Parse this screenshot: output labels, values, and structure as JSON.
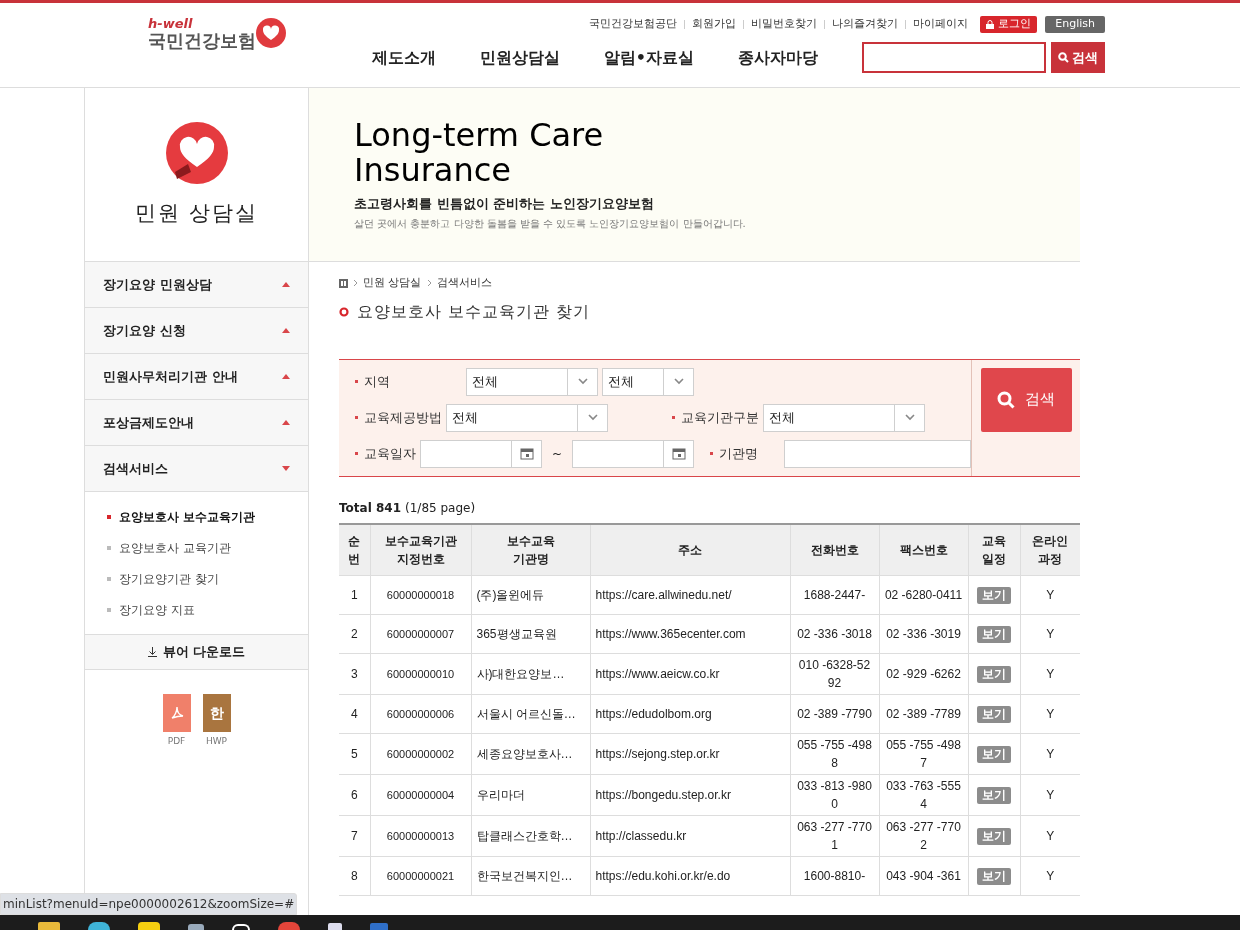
{
  "header": {
    "logo_tagline": "h-well",
    "logo_name": "국민건강보험",
    "util_links": [
      "국민건강보험공단",
      "회원가입",
      "비밀번호찾기",
      "나의즐겨찾기",
      "마이페이지"
    ],
    "login_button": "로그인",
    "english_button": "English",
    "nav": [
      "제도소개",
      "민원상담실",
      "알림•자료실",
      "종사자마당"
    ],
    "search_button": "검색"
  },
  "sidebar": {
    "title": "민원 상담실",
    "items": [
      {
        "label": "장기요양 민원상담",
        "expanded": false
      },
      {
        "label": "장기요양 신청",
        "expanded": false
      },
      {
        "label": "민원사무처리기관 안내",
        "expanded": false
      },
      {
        "label": "포상금제도안내",
        "expanded": false
      },
      {
        "label": "검색서비스",
        "expanded": true,
        "children": [
          {
            "label": "요양보호사 보수교육기관",
            "selected": true
          },
          {
            "label": "요양보호사 교육기관",
            "selected": false
          },
          {
            "label": "장기요양기관 찾기",
            "selected": false
          },
          {
            "label": "장기요양 지표",
            "selected": false
          }
        ]
      }
    ],
    "download": "뷰어 다운로드",
    "viewers": [
      {
        "kind": "pdf",
        "label": "PDF"
      },
      {
        "kind": "hwp",
        "label": "HWP",
        "glyph": "한"
      }
    ]
  },
  "banner": {
    "title_line1": "Long-term Care",
    "title_line2": "Insurance",
    "subtitle": "초고령사회를 빈틈없이 준비하는 노인장기요양보험",
    "description": "살던 곳에서 충분하고 다양한 돌봄을 받을 수 있도록 노인장기요양보험이 만들어갑니다."
  },
  "breadcrumb": [
    "민원 상담실",
    "검색서비스"
  ],
  "page_title": "요양보호사 보수교육기관 찾기",
  "filters": {
    "region_label": "지역",
    "region_1": "전체",
    "region_2": "전체",
    "method_label": "교육제공방법",
    "method": "전체",
    "type_label": "교육기관구분",
    "type": "전체",
    "date_label": "교육일자",
    "date_sep": "~",
    "name_label": "기관명",
    "search_button": "검색"
  },
  "total": {
    "label": "Total 841",
    "pages": "(1/85 page)"
  },
  "table": {
    "columns": [
      "순\n번",
      "보수교육기관\n지정번호",
      "보수교육\n기관명",
      "주소",
      "전화번호",
      "팩스번호",
      "교육\n일정",
      "온라인\n과정"
    ],
    "rows": [
      {
        "cells": [
          "1",
          "60000000018",
          "(주)올윈에듀",
          "https://care.allwinedu.net/",
          "1688-2447-",
          "02 -6280-0411",
          "보기",
          "Y"
        ]
      },
      {
        "cells": [
          "2",
          "60000000007",
          "365평생교육원",
          "https://www.365ecenter.com",
          "02 -336 -3018",
          "02 -336 -3019",
          "보기",
          "Y"
        ]
      },
      {
        "cells": [
          "3",
          "60000000010",
          "사)대한요양보…",
          "https://www.aeicw.co.kr",
          "010 -6328-5292",
          "02 -929 -6262",
          "보기",
          "Y"
        ]
      },
      {
        "cells": [
          "4",
          "60000000006",
          "서울시 어르신돌…",
          "https://edudolbom.org",
          "02 -389 -7790",
          "02 -389 -7789",
          "보기",
          "Y"
        ]
      },
      {
        "cells": [
          "5",
          "60000000002",
          "세종요양보호사…",
          "https://sejong.step.or.kr",
          "055 -755 -4988",
          "055 -755 -4987",
          "보기",
          "Y"
        ]
      },
      {
        "cells": [
          "6",
          "60000000004",
          "우리마더",
          "https://bongedu.step.or.kr",
          "033 -813 -9800",
          "033 -763 -5554",
          "보기",
          "Y"
        ]
      },
      {
        "cells": [
          "7",
          "60000000013",
          "탑클래스간호학…",
          "http://classedu.kr",
          "063 -277 -7701",
          "063 -277 -7702",
          "보기",
          "Y"
        ]
      },
      {
        "cells": [
          "8",
          "60000000021",
          "한국보건복지인…",
          "https://edu.kohi.or.kr/e.do",
          "1600-8810-",
          "043 -904 -361",
          "보기",
          "Y"
        ]
      }
    ]
  },
  "status_url": "minList?menuId=npe0000002612&zoomSize=#"
}
